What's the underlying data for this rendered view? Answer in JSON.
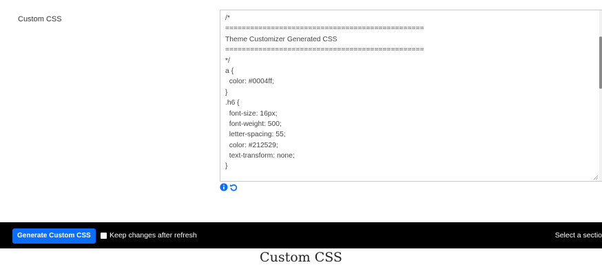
{
  "field": {
    "label": "Custom CSS",
    "code_lines": [
      "/*",
      "================================================",
      "Theme Customizer Generated CSS",
      "================================================",
      "*/",
      "a {",
      "  color: #0004ff;",
      "}",
      ".h6 {",
      "  font-size: 16px;",
      "  font-weight: 500;",
      "  letter-spacing: 55;",
      "  color: #212529;",
      "  text-transform: none;",
      "}"
    ],
    "icons": [
      "info-icon",
      "reset-icon"
    ]
  },
  "toolbar": {
    "generate_label": "Generate Custom CSS",
    "keep_changes_label": "Keep changes after refresh",
    "keep_changes_checked": false,
    "section_placeholder": "Select a sectio"
  },
  "caption": "Custom CSS",
  "colors": {
    "accent": "#0d6efd",
    "toolbar_bg": "#000000",
    "icon_blue": "#0d6efd"
  }
}
